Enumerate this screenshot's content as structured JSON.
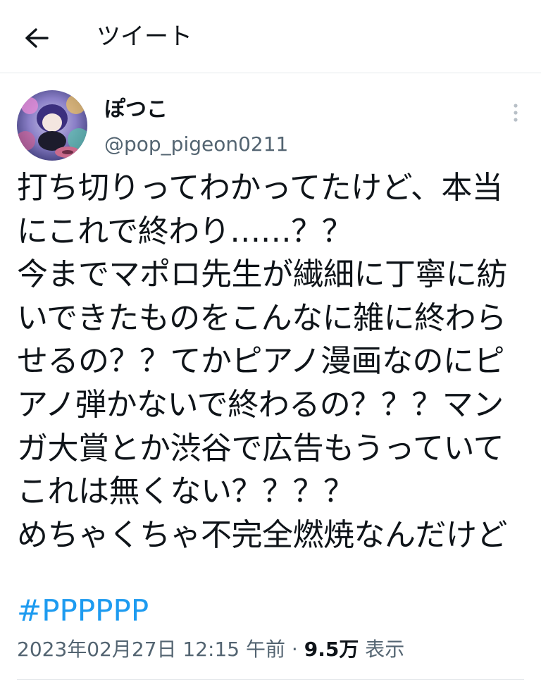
{
  "header": {
    "title": "ツイート",
    "back_icon": "arrow-left-icon"
  },
  "author": {
    "display_name": "ぽつこ",
    "handle": "@pop_pigeon0211",
    "avatar_icon": "avatar-image"
  },
  "tweet": {
    "lines": [
      "打ち切りってわかってたけど、本当",
      "にこれで終わり……？？",
      "今までマポロ先生が繊細に丁寧に紡",
      "いできたものをこんなに雑に終わら",
      "せるの？？てかピアノ漫画なのにピ",
      "アノ弾かないで終わるの？？？マン",
      "ガ大賞とか渋谷で広告もうっていて",
      "これは無くない？？？？",
      "めちゃくちゃ不完全燃焼なんだけど"
    ],
    "hashtag": "#PPPPPP"
  },
  "meta": {
    "timestamp": "2023年02月27日 12:15 午前",
    "separator": "·",
    "views_count": "9.5万",
    "views_label": "表示"
  },
  "colors": {
    "text": "#0f1419",
    "secondary": "#536471",
    "accent": "#1d9bf0",
    "divider": "#e6e9ec"
  }
}
